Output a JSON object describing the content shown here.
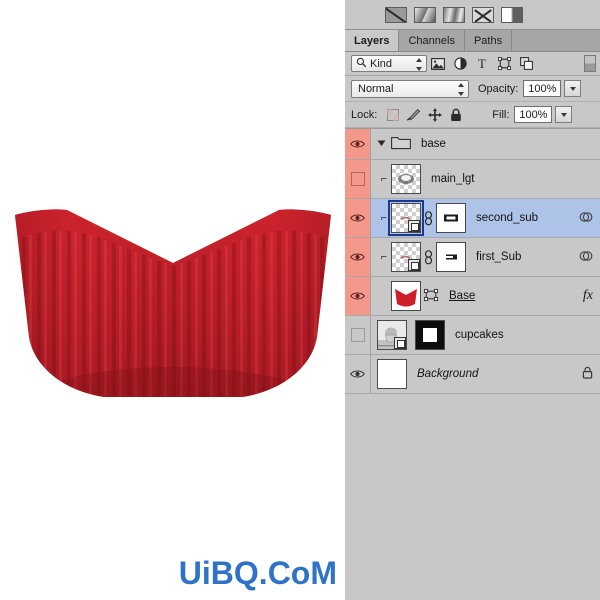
{
  "app": {
    "panel_title": "Layers"
  },
  "presets": {
    "name": "gradient-preset-strip",
    "swatches": [
      {
        "id": "preset-1",
        "label": "solid-dark"
      },
      {
        "id": "preset-2",
        "label": "linear-diagonal"
      },
      {
        "id": "preset-3",
        "label": "wave-gradient"
      },
      {
        "id": "preset-4",
        "label": "cross-gradient"
      },
      {
        "id": "preset-5",
        "label": "half-split"
      }
    ]
  },
  "tabs": [
    {
      "label": "Layers",
      "active": true
    },
    {
      "label": "Channels",
      "active": false
    },
    {
      "label": "Paths",
      "active": false
    }
  ],
  "filter_bar": {
    "kind_label": "Kind",
    "search_icon": "search-icon",
    "icons": [
      {
        "name": "pixel-layer-filter-icon",
        "glyph": "image"
      },
      {
        "name": "adjustment-layer-filter-icon",
        "glyph": "circle-half"
      },
      {
        "name": "type-layer-filter-icon",
        "glyph": "T"
      },
      {
        "name": "shape-layer-filter-icon",
        "glyph": "shape"
      },
      {
        "name": "smart-object-filter-icon",
        "glyph": "smart"
      }
    ],
    "toggle_name": "filter-enable-toggle"
  },
  "blend_bar": {
    "blend_mode": "Normal",
    "opacity_label": "Opacity:",
    "opacity_value": "100%"
  },
  "lock_bar": {
    "lock_label": "Lock:",
    "lock_icons": [
      {
        "name": "lock-transparent-pixels-icon"
      },
      {
        "name": "lock-image-pixels-icon"
      },
      {
        "name": "lock-position-icon"
      },
      {
        "name": "lock-all-icon"
      }
    ],
    "fill_label": "Fill:",
    "fill_value": "100%"
  },
  "layers": [
    {
      "name": "base",
      "type": "group",
      "visible": true,
      "eye_highlight": true,
      "selected": false,
      "expanded": true,
      "indented": false,
      "has_thumb": false,
      "has_mask": false,
      "linked": false,
      "clipped": false,
      "has_fx": false,
      "locked": false,
      "underline": false,
      "italic": false
    },
    {
      "name": "main_lgt",
      "type": "pixel",
      "visible": false,
      "eye_highlight": true,
      "selected": false,
      "indented": true,
      "has_thumb": true,
      "thumb_style": "checker-glow",
      "has_mask": false,
      "linked": false,
      "clipped": false,
      "has_fx": false,
      "locked": false,
      "underline": false,
      "italic": false
    },
    {
      "name": "second_sub",
      "type": "pixel",
      "visible": true,
      "eye_highlight": true,
      "selected": true,
      "indented": true,
      "has_thumb": true,
      "thumb_style": "checker-smart",
      "has_mask": true,
      "mask_style": "rect-outline",
      "linked": true,
      "clipped": true,
      "has_fx": false,
      "locked": false,
      "underline": false,
      "italic": false
    },
    {
      "name": "first_Sub",
      "type": "pixel",
      "visible": true,
      "eye_highlight": true,
      "selected": false,
      "indented": true,
      "has_thumb": true,
      "thumb_style": "checker-smart",
      "has_mask": true,
      "mask_style": "small-shape",
      "linked": true,
      "clipped": true,
      "has_fx": false,
      "locked": false,
      "underline": false,
      "italic": false
    },
    {
      "name": "Base",
      "type": "shape",
      "visible": true,
      "eye_highlight": true,
      "selected": false,
      "indented": false,
      "has_thumb": true,
      "thumb_style": "red-cup",
      "has_mask": false,
      "vector_badge": true,
      "linked": false,
      "clipped": false,
      "has_fx": true,
      "fx_label": "fx",
      "locked": false,
      "underline": true,
      "italic": false
    },
    {
      "name": "cupcakes",
      "type": "smart-object",
      "visible": false,
      "eye_highlight": false,
      "selected": false,
      "indented": false,
      "has_thumb": true,
      "thumb_style": "photo-gray",
      "has_mask": true,
      "mask_style": "black-white-square",
      "linked": false,
      "clipped": false,
      "has_fx": false,
      "locked": false,
      "underline": false,
      "italic": false
    },
    {
      "name": "Background",
      "type": "background",
      "visible": true,
      "eye_highlight": false,
      "selected": false,
      "indented": false,
      "has_thumb": true,
      "thumb_style": "white",
      "has_mask": false,
      "linked": false,
      "clipped": false,
      "has_fx": false,
      "locked": true,
      "underline": false,
      "italic": true
    }
  ],
  "canvas": {
    "artwork_name": "red-cupcake-wrapper",
    "background_color": "#ffffff",
    "colors": {
      "red_light": "#d1242e",
      "red_mid": "#b81c25",
      "red_dark": "#8e141c"
    }
  },
  "watermark": {
    "text": "UiBQ.CoM",
    "color": "#2f73c8"
  }
}
